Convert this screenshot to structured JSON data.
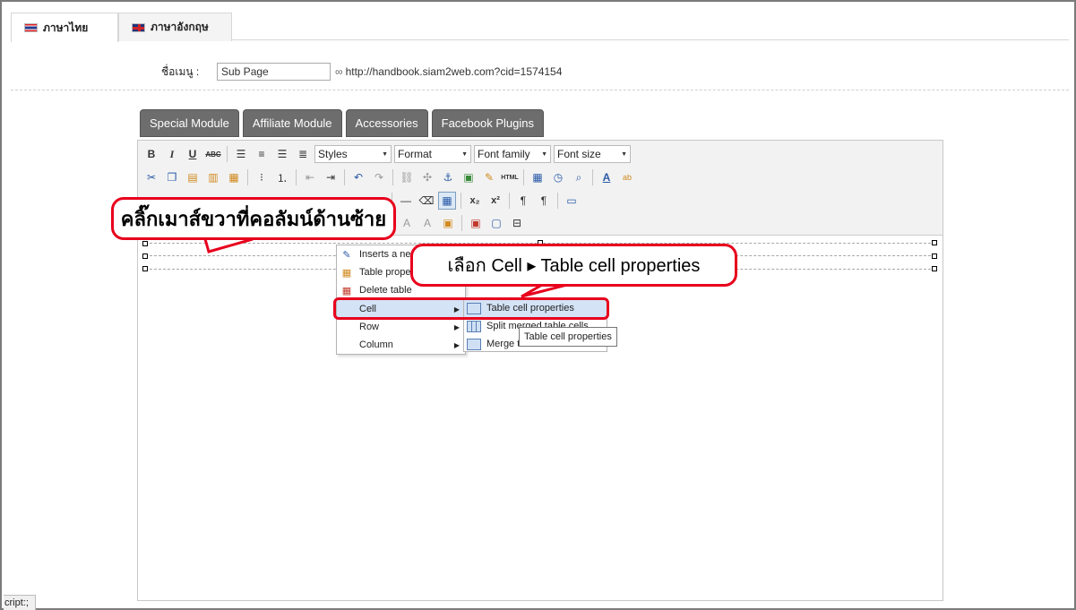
{
  "tabs": [
    {
      "label": "ภาษาไทย",
      "flag": "thai-flag-icon",
      "active": true
    },
    {
      "label": "ภาษาอังกฤษ",
      "flag": "uk-flag-icon",
      "active": false
    }
  ],
  "menu": {
    "label": "ชื่อเมนู :",
    "value": "Sub Page",
    "url": "http://handbook.siam2web.com?cid=1574154"
  },
  "module_buttons": [
    "Special Module",
    "Affiliate Module",
    "Accessories",
    "Facebook Plugins"
  ],
  "toolbar": {
    "styles": "Styles",
    "format": "Format",
    "font_family": "Font family",
    "font_size": "Font size",
    "html_label": "HTML"
  },
  "context_menu": {
    "items": [
      {
        "label": "Inserts a ne",
        "icon": "insert-table-icon"
      },
      {
        "label": "Table prope",
        "icon": "table-properties-icon"
      },
      {
        "label": "Delete table",
        "icon": "delete-table-icon"
      },
      {
        "label": "Cell",
        "submenu": true,
        "highlighted": true
      },
      {
        "label": "Row",
        "submenu": true
      },
      {
        "label": "Column",
        "submenu": true
      }
    ]
  },
  "submenu": {
    "items": [
      {
        "label": "Table cell properties",
        "icon": "cell-properties-icon",
        "highlighted": true
      },
      {
        "label": "Split merged table cells",
        "icon": "split-cells-icon"
      },
      {
        "label": "Merge t",
        "icon": "merge-cells-icon"
      }
    ]
  },
  "tooltip": "Table cell properties",
  "callouts": {
    "left": "คลิ๊กเมาส์ขวาที่คอลัมน์ด้านซ้าย",
    "right": "เลือก Cell  ▸ Table cell properties"
  },
  "status_bar": "cript:;",
  "colors": {
    "callout_border": "#e8001c",
    "module_button": "#6d6d6d",
    "menu_highlight": "#d4e3f6"
  }
}
